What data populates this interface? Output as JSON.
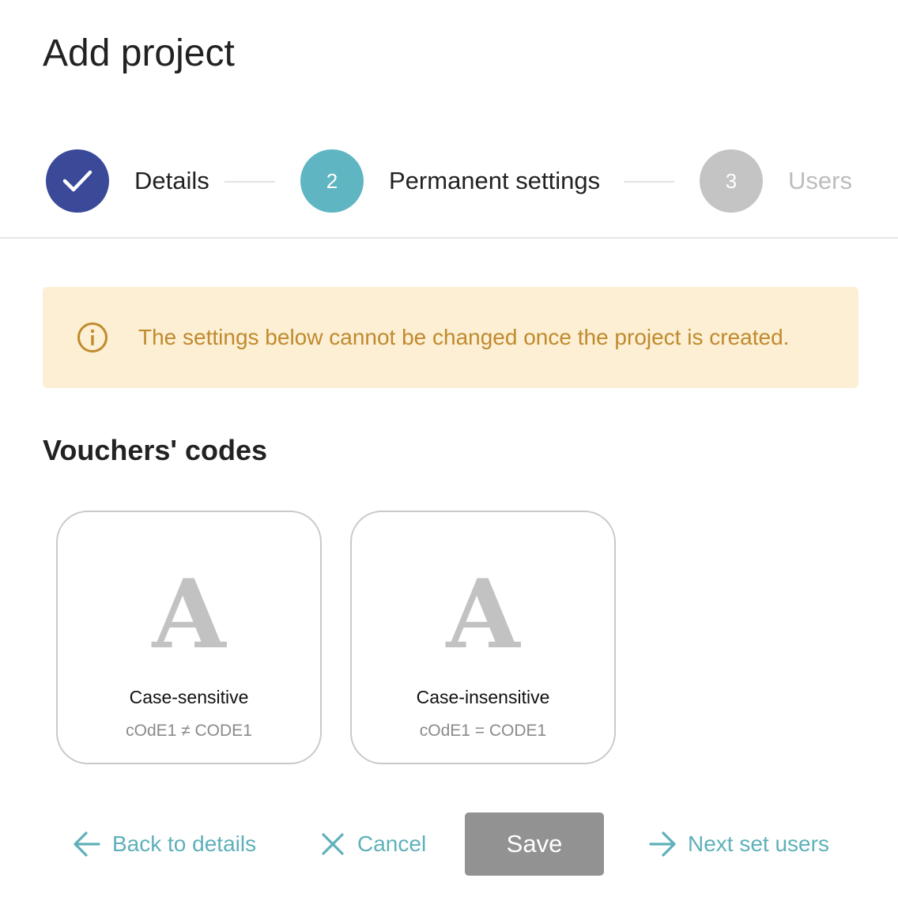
{
  "page": {
    "title": "Add project"
  },
  "stepper": {
    "steps": [
      {
        "label": "Details",
        "number": "",
        "state": "completed",
        "icon": "check-icon",
        "color": "#3a4a99"
      },
      {
        "label": "Permanent settings",
        "number": "2",
        "state": "active",
        "color": "#5fb6c2"
      },
      {
        "label": "Users",
        "number": "3",
        "state": "pending",
        "color": "#c4c4c4"
      }
    ]
  },
  "alert": {
    "icon": "info-icon",
    "text": "The settings below cannot be changed once the project is created.",
    "background": "#fcefd3",
    "color": "#c08a2e"
  },
  "vouchers": {
    "title": "Vouchers' codes",
    "options": [
      {
        "glyph": "A",
        "title": "Case-sensitive",
        "example": "cOdE1 ≠ CODE1"
      },
      {
        "glyph": "A",
        "title": "Case-insensitive",
        "example": "cOdE1 = CODE1"
      }
    ]
  },
  "actions": {
    "back_label": "Back to details",
    "back_icon": "arrow-left-icon",
    "cancel_label": "Cancel",
    "cancel_icon": "close-icon",
    "save_label": "Save",
    "next_label": "Next set users",
    "next_icon": "arrow-right-icon",
    "accent_color": "#5fb0bb"
  }
}
